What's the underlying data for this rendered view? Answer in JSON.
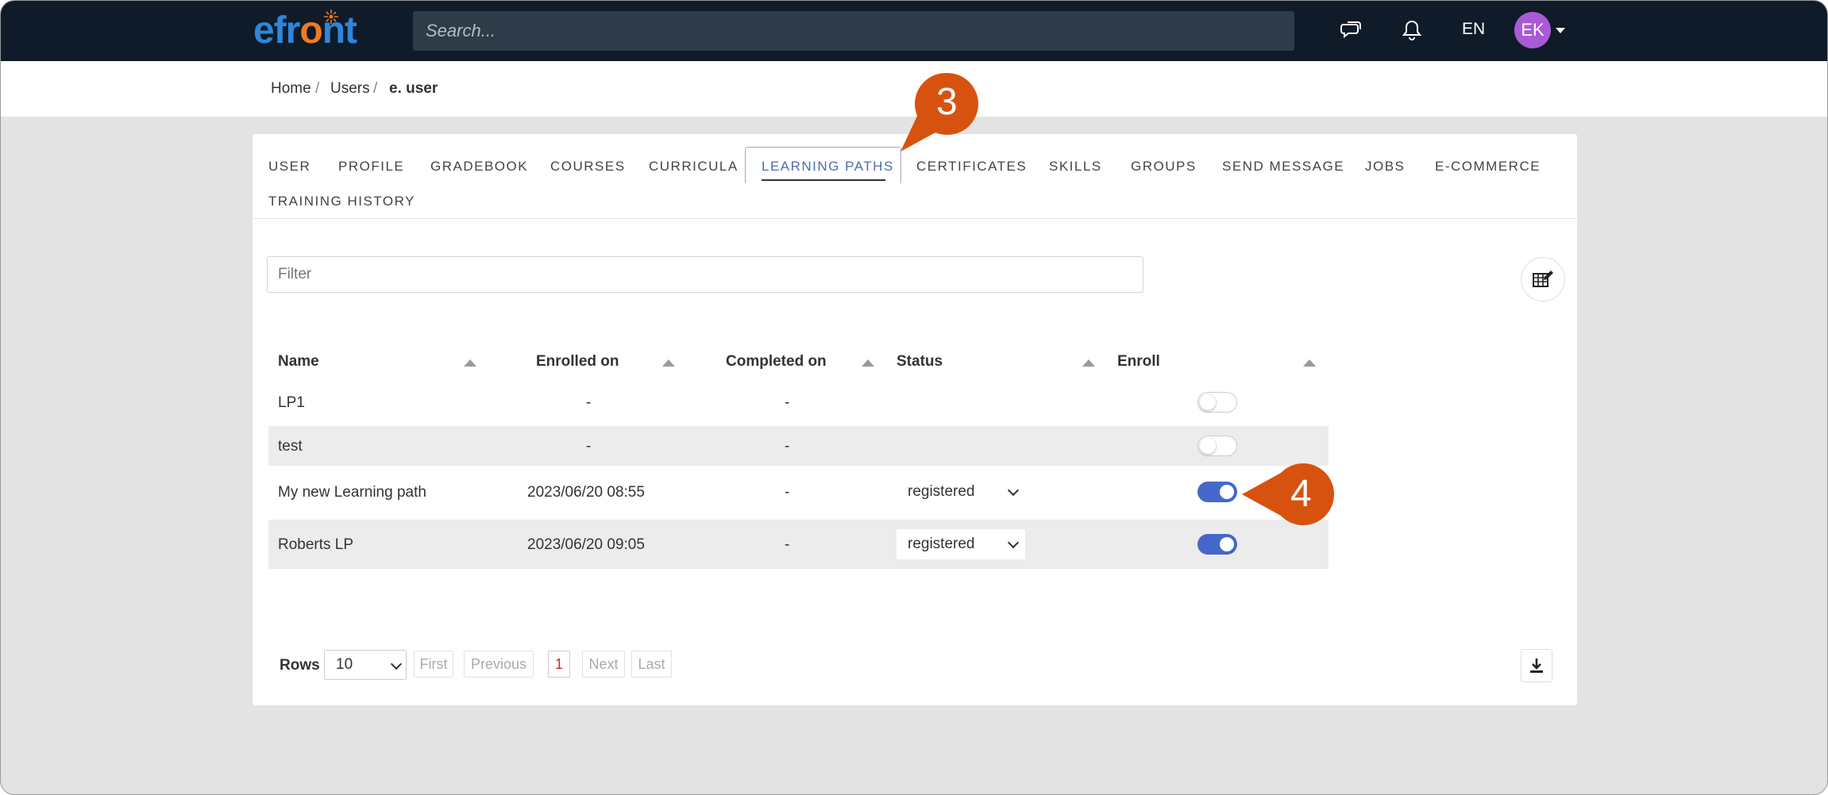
{
  "topbar": {
    "logo_prefix": "efr",
    "logo_o": "o",
    "logo_suffix": "nt",
    "search_placeholder": "Search...",
    "language": "EN",
    "avatar_initials": "EK",
    "chat_icon": "chat-icon",
    "bell_icon": "bell-icon"
  },
  "breadcrumb": {
    "items": [
      "Home",
      "Users",
      "e. user"
    ],
    "separator": "/"
  },
  "tabs": {
    "items": [
      "USER",
      "PROFILE",
      "GRADEBOOK",
      "COURSES",
      "CURRICULA",
      "LEARNING PATHS",
      "CERTIFICATES",
      "SKILLS",
      "GROUPS",
      "SEND MESSAGE",
      "JOBS",
      "E-COMMERCE",
      "TRAINING HISTORY"
    ],
    "active": "LEARNING PATHS"
  },
  "filter": {
    "placeholder": "Filter"
  },
  "table": {
    "headers": [
      "Name",
      "Enrolled on",
      "Completed on",
      "Status",
      "Enroll"
    ],
    "rows": [
      {
        "name": "LP1",
        "enrolled_on": "-",
        "completed_on": "-",
        "status": "",
        "enrolled": false
      },
      {
        "name": "test",
        "enrolled_on": "-",
        "completed_on": "-",
        "status": "",
        "enrolled": false
      },
      {
        "name": "My new Learning path",
        "enrolled_on": "2023/06/20 08:55",
        "completed_on": "-",
        "status": "registered",
        "enrolled": true
      },
      {
        "name": "Roberts LP",
        "enrolled_on": "2023/06/20 09:05",
        "completed_on": "-",
        "status": "registered",
        "enrolled": true
      }
    ]
  },
  "pagination": {
    "rows_label": "Rows",
    "rows_value": "10",
    "first": "First",
    "previous": "Previous",
    "current_page": "1",
    "next": "Next",
    "last": "Last"
  },
  "callouts": [
    "3",
    "4"
  ],
  "colors": {
    "topbar_bg": "#0f1b28",
    "accent": "#4567c9",
    "callout": "#d8520f",
    "active_tab": "#4f6bb5",
    "current_page": "#d02626"
  }
}
